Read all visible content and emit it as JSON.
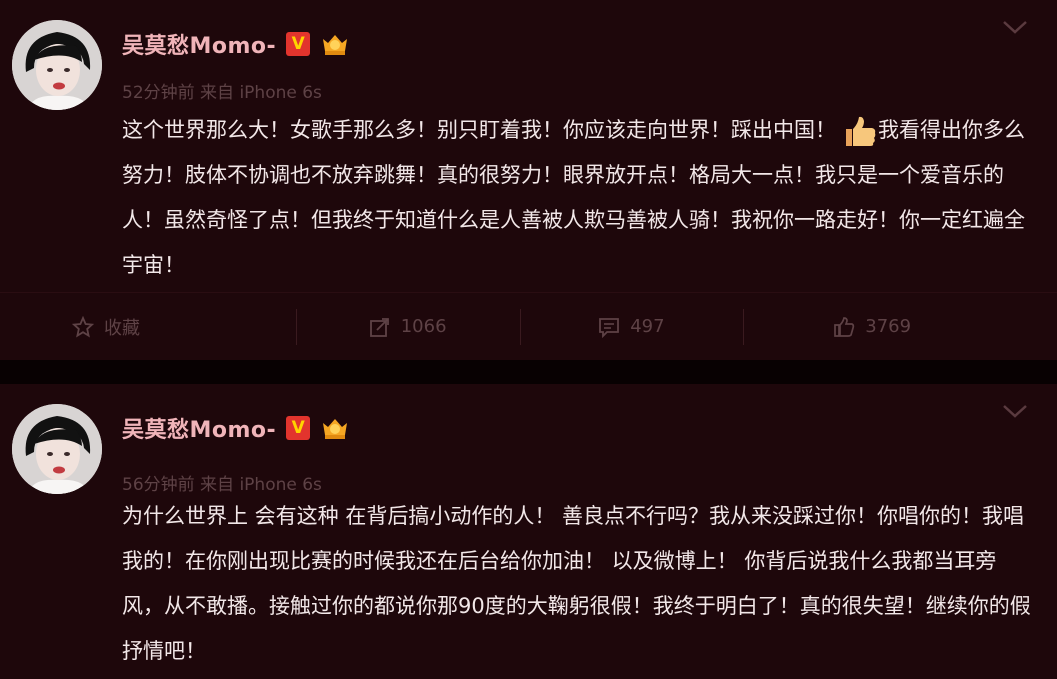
{
  "posts": [
    {
      "author": "吴莫愁Momo-",
      "verified_badge": "V",
      "time": "52分钟前",
      "source": "来自 iPhone 6s",
      "content": "这个世界那么大！女歌手那么多！别只盯着我！你应该走向世界！踩出中国！",
      "content_rest": "我看得出你多么努力！肢体不协调也不放弃跳舞！真的很努力！眼界放开点！格局大一点！我只是一个爱音乐的人！虽然奇怪了点！但我终于知道什么是人善被人欺马善被人骑！我祝你一路走好！你一定红遍全宇宙！",
      "actions": {
        "favorite": "收藏",
        "repost": "1066",
        "comment": "497",
        "like": "3769"
      }
    },
    {
      "author": "吴莫愁Momo-",
      "verified_badge": "V",
      "time": "56分钟前",
      "source": "来自 iPhone 6s",
      "content": "为什么世界上 会有这种 在背后搞小动作的人！ 善良点不行吗？我从来没踩过你！你唱你的！我唱我的！在你刚出现比赛的时候我还在后台给你加油！ 以及微博上！ 你背后说我什么我都当耳旁风，从不敢播。接触过你的都说你那90度的大鞠躬很假！我终于明白了！真的很失望！继续你的假抒情吧！"
    }
  ],
  "colors": {
    "card_background": "#1e070b",
    "author_name": "#f0b4b9",
    "body_text": "#f2e7e8",
    "meta_text": "#5e4246",
    "verified_badge": "#e2342d"
  },
  "icons": [
    "chevron-down-icon",
    "member-crown-icon",
    "thumbs-up-emoji",
    "star-icon",
    "repost-icon",
    "comment-icon",
    "like-icon"
  ]
}
